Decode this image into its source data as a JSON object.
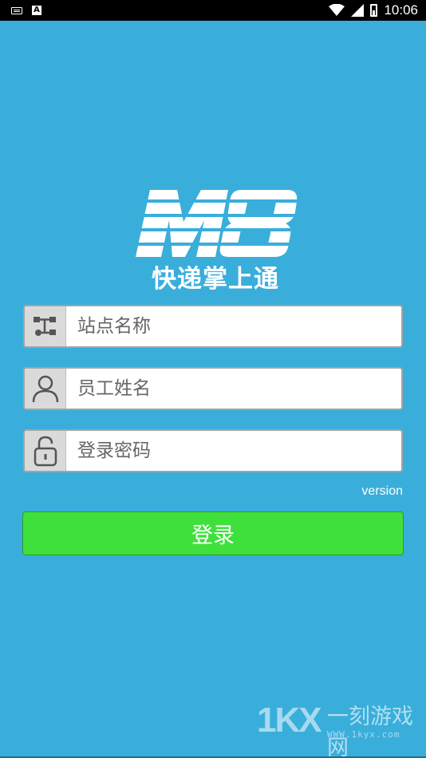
{
  "status_bar": {
    "time": "10:06",
    "left_icons": [
      "keyboard-icon",
      "a-notification-icon"
    ],
    "right_icons": [
      "wifi-icon",
      "signal-icon",
      "battery-icon"
    ]
  },
  "logo": {
    "mark": "M8",
    "app_name": "快递掌上通"
  },
  "form": {
    "station": {
      "placeholder": "站点名称",
      "value": "",
      "icon": "network-icon"
    },
    "employee": {
      "placeholder": "员工姓名",
      "value": "",
      "icon": "user-icon"
    },
    "password": {
      "placeholder": "登录密码",
      "value": "",
      "icon": "lock-icon"
    }
  },
  "version_label": "version",
  "login_button": "登录",
  "watermark": {
    "logo": "1KX",
    "name": "一刻游戏网",
    "url": "WWW.1kyx.com"
  },
  "colors": {
    "background": "#3aaedb",
    "button": "#40e03c",
    "field_icon_bg": "#dadada"
  }
}
